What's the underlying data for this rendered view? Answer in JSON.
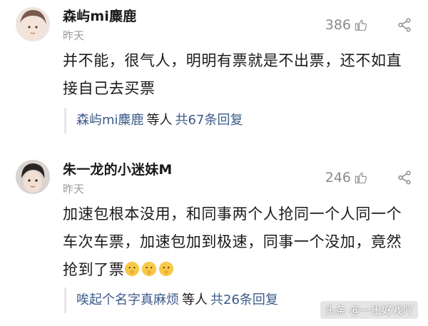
{
  "comments": [
    {
      "username": "森屿mi麋鹿",
      "time": "昨天",
      "likes": "386",
      "text": "并不能，很气人，明明有票就是不出票，还不如直接自己去买票",
      "reply": {
        "users": "森屿mi麋鹿",
        "mid": "等人",
        "count": "共67条回复"
      }
    },
    {
      "username": "朱一龙的小迷妹M",
      "time": "昨天",
      "likes": "246",
      "text": "加速包根本没用，和同事两个人抢同一个人同一个车次车票，加速包加到极速，同事一个没加，竟然抢到了票",
      "reply": {
        "users": "唉起个名字真麻烦",
        "mid": "等人",
        "count": "共26条回复"
      }
    }
  ],
  "watermark": "头条 @一出好戏吖",
  "icons": {
    "like": "thumbs-up-icon",
    "share": "share-icon",
    "emoji": "shush-face-emoji"
  },
  "colors": {
    "link": "#3c5a8a",
    "muted": "#9a9a9a"
  }
}
